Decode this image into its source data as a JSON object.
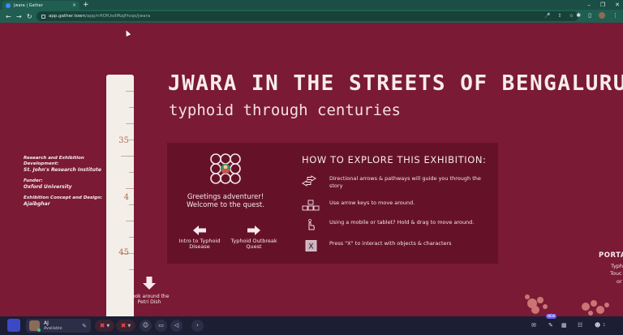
{
  "browser": {
    "tab_title": "Jwara | Gather",
    "tab_close": "×",
    "new_tab": "+",
    "url_host": "app.gather.town",
    "url_path": "/app/nHOfUsdfRaJHvqo/jwara",
    "window_controls": [
      "–",
      "❐",
      "✕"
    ]
  },
  "exhibit": {
    "title": "JWARA IN THE STREETS OF BENGALURU",
    "subtitle": "typhoid through centuries"
  },
  "credits": [
    {
      "heading": "Research and Exhibition Development:",
      "value": "St. John's Research Institute"
    },
    {
      "heading": "Funder:",
      "value": "Oxford University"
    },
    {
      "heading": "Exhibition Concept and Design:",
      "value": "Ajaibghar"
    }
  ],
  "ruler_marks": [
    "35",
    "4",
    "45"
  ],
  "panel": {
    "greeting_line1": "Greetings adventurer!",
    "greeting_line2": "Welcome to the quest.",
    "intro_label": "Intro to Typhoid Disease",
    "outbreak_label": "Typhoid Outbreak Quest",
    "howto_heading": "HOW TO EXPLORE THIS EXHIBITION:",
    "howto": [
      {
        "icon": "directional-arrows-icon",
        "text": "Directional arrows & pathways will guide you through the story"
      },
      {
        "icon": "arrow-keys-icon",
        "text": "Use arrow keys to move around."
      },
      {
        "icon": "hand-drag-icon",
        "text": "Using a mobile or tablet? Hold & drag to move around."
      },
      {
        "icon": "x-key-icon",
        "text": "Press \"X\" to interact with objects & characters"
      }
    ]
  },
  "look_label": "Look around the Petri Dish",
  "portal": {
    "label": "PORTA",
    "line1": "Typh",
    "line2": "Touc",
    "line3": "or"
  },
  "dock": {
    "user_name": "AJ",
    "user_status": "Available",
    "new_badge": "NEW",
    "participant_count": "1"
  },
  "colors": {
    "background": "#7a1a35",
    "panel": "#651229",
    "browser": "#205e52",
    "dock": "#1c1e33"
  }
}
